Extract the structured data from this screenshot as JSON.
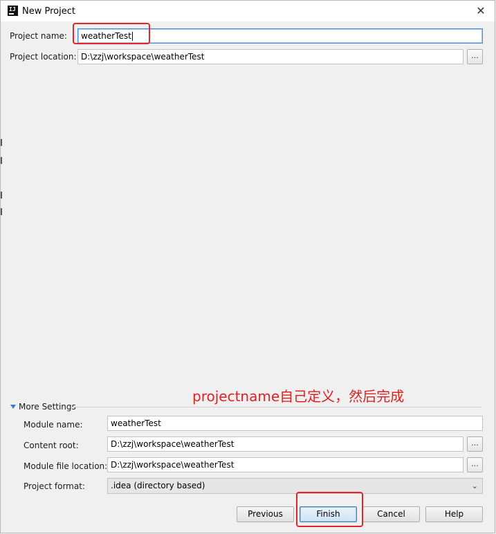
{
  "window": {
    "title": "New Project",
    "app_icon_text": "IJ",
    "close_glyph": "✕"
  },
  "form": {
    "project_name_label": "Project name:",
    "project_name_value": "weatherTest",
    "project_location_label": "Project location:",
    "project_location_value": "D:\\zzj\\workspace\\weatherTest",
    "browse_glyph": "..."
  },
  "annotation": {
    "text": "projectname自己定义，然后完成",
    "color": "#e5232b"
  },
  "more_settings": {
    "header": "More Settings",
    "module_name_label": "Module name:",
    "module_name_value": "weatherTest",
    "content_root_label": "Content root:",
    "content_root_value": "D:\\zzj\\workspace\\weatherTest",
    "module_file_location_label": "Module file location:",
    "module_file_location_value": "D:\\zzj\\workspace\\weatherTest",
    "project_format_label": "Project format:",
    "project_format_value": ".idea (directory based)"
  },
  "buttons": {
    "previous": "Previous",
    "finish": "Finish",
    "cancel": "Cancel",
    "help": "Help"
  },
  "colors": {
    "accent": "#4a8bd4",
    "annotation_red": "#e5232b"
  }
}
